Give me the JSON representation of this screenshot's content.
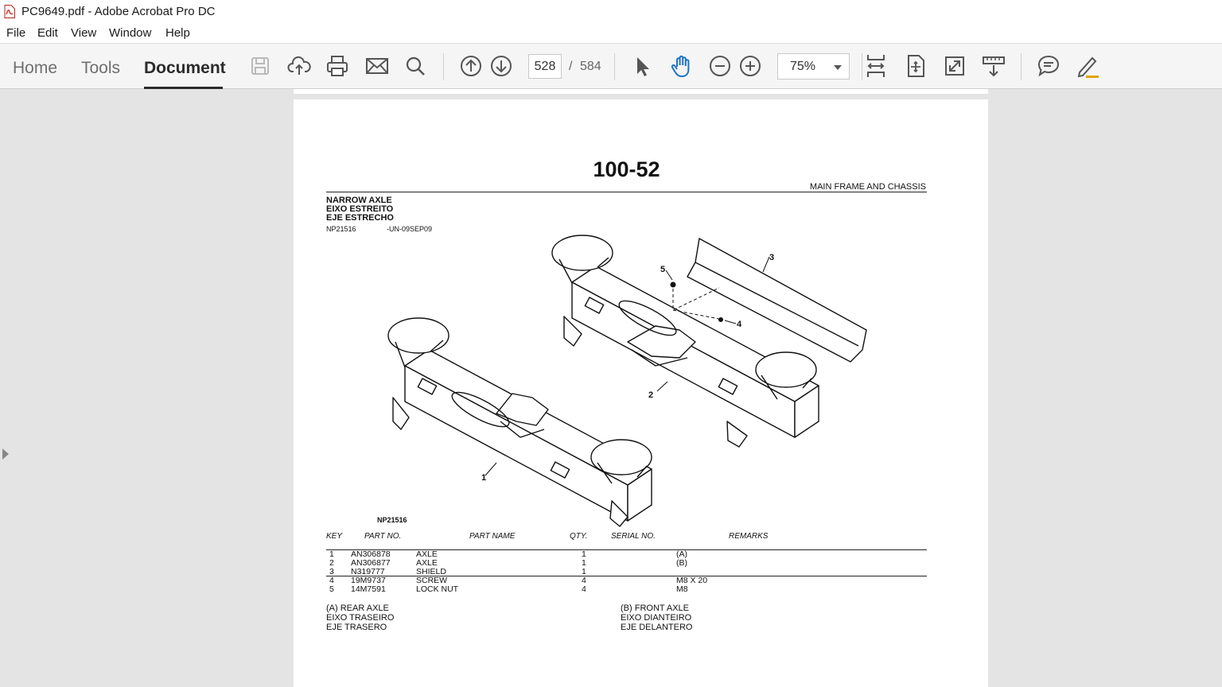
{
  "window": {
    "title": "PC9649.pdf - Adobe Acrobat Pro DC"
  },
  "menu": [
    "File",
    "Edit",
    "View",
    "Window",
    "Help"
  ],
  "tabs": {
    "home": "Home",
    "tools": "Tools",
    "document": "Document"
  },
  "navigation": {
    "current_page": "528",
    "separator": "/",
    "total_pages": "584"
  },
  "zoom": {
    "value": "75%"
  },
  "icons": [
    "save-icon",
    "cloud-upload-icon",
    "print-icon",
    "mail-icon",
    "search-icon",
    "page-up-icon",
    "page-down-icon",
    "select-cursor-icon",
    "hand-icon",
    "zoom-out-icon",
    "zoom-in-icon",
    "fit-width-icon",
    "fit-page-icon",
    "fullscreen-icon",
    "scroll-mode-icon",
    "comment-icon",
    "pen-icon"
  ],
  "document": {
    "page_number": "100-52",
    "section": "MAIN FRAME AND CHASSIS",
    "heading": [
      "NARROW AXLE",
      "EIXO ESTREITO",
      "EJE ESTRECHO"
    ],
    "ref_id": "NP21516",
    "ref_code": "-UN-09SEP09",
    "figure_label": "NP21516",
    "callouts": [
      "1",
      "2",
      "3",
      "4",
      "5"
    ],
    "columns": {
      "key": "KEY",
      "part_no": "PART NO.",
      "part_name": "PART NAME",
      "qty": "QTY.",
      "serial": "SERIAL NO.",
      "remarks": "REMARKS"
    },
    "rows": [
      {
        "key": "1",
        "part_no": "AN306878",
        "name": "AXLE",
        "qty": "1",
        "remarks": "(A)"
      },
      {
        "key": "2",
        "part_no": "AN306877",
        "name": "AXLE",
        "qty": "1",
        "remarks": "(B)"
      },
      {
        "key": "3",
        "part_no": "N319777",
        "name": "SHIELD",
        "qty": "1",
        "remarks": ""
      },
      {
        "key": "4",
        "part_no": "19M9737",
        "name": "SCREW",
        "qty": "4",
        "remarks": "M8 X 20"
      },
      {
        "key": "5",
        "part_no": "14M7591",
        "name": "LOCK NUT",
        "qty": "4",
        "remarks": "M8"
      }
    ],
    "notes": {
      "a": [
        "(A) REAR AXLE",
        "EIXO TRASEIRO",
        "EJE TRASERO"
      ],
      "b": [
        "(B) FRONT AXLE",
        "EIXO DIANTEIRO",
        "EJE DELANTERO"
      ]
    }
  },
  "colors": {
    "accent_blue": "#1a73c9",
    "toolbar_bg": "#f5f5f5",
    "canvas_bg": "#e4e4e4"
  }
}
